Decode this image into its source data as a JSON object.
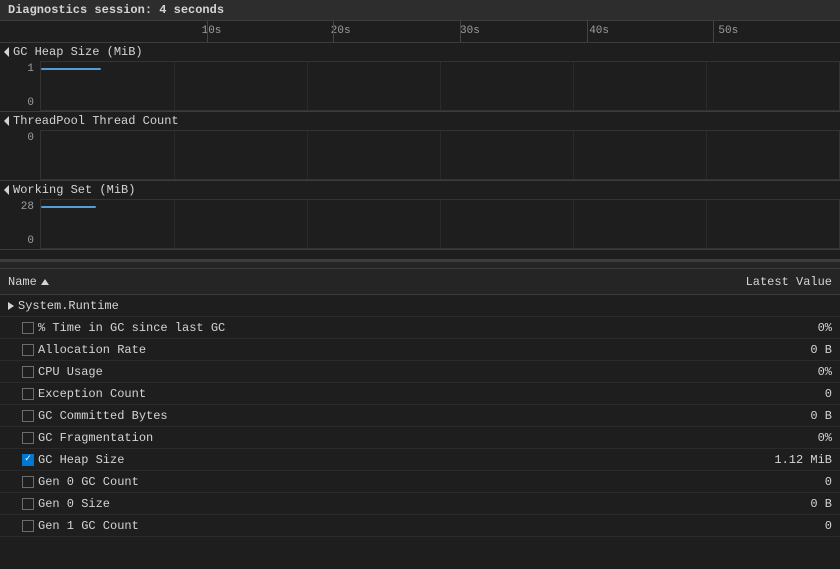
{
  "diagnostics": {
    "session_label": "Diagnostics session: 4 seconds"
  },
  "timeline": {
    "labels": [
      "10s",
      "20s",
      "30s",
      "40s",
      "50s"
    ]
  },
  "charts": [
    {
      "id": "gc-heap",
      "title": "GC Heap Size (MiB)",
      "y_max": "1",
      "y_min": "0"
    },
    {
      "id": "threadpool",
      "title": "ThreadPool Thread Count",
      "y_max": "0",
      "y_min": ""
    },
    {
      "id": "working-set",
      "title": "Working Set (MiB)",
      "y_max": "28",
      "y_min": "0"
    }
  ],
  "table": {
    "col_name": "Name",
    "col_value": "Latest Value",
    "category": "System.Runtime",
    "rows": [
      {
        "name": "% Time in GC since last GC",
        "value": "0%",
        "checked": false
      },
      {
        "name": "Allocation Rate",
        "value": "0 B",
        "checked": false
      },
      {
        "name": "CPU Usage",
        "value": "0%",
        "checked": false
      },
      {
        "name": "Exception Count",
        "value": "0",
        "checked": false
      },
      {
        "name": "GC Committed Bytes",
        "value": "0 B",
        "checked": false
      },
      {
        "name": "GC Fragmentation",
        "value": "0%",
        "checked": false
      },
      {
        "name": "GC Heap Size",
        "value": "1.12 MiB",
        "checked": true
      },
      {
        "name": "Gen 0 GC Count",
        "value": "0",
        "checked": false
      },
      {
        "name": "Gen 0 Size",
        "value": "0 B",
        "checked": false
      },
      {
        "name": "Gen 1 GC Count",
        "value": "0",
        "checked": false
      }
    ]
  }
}
